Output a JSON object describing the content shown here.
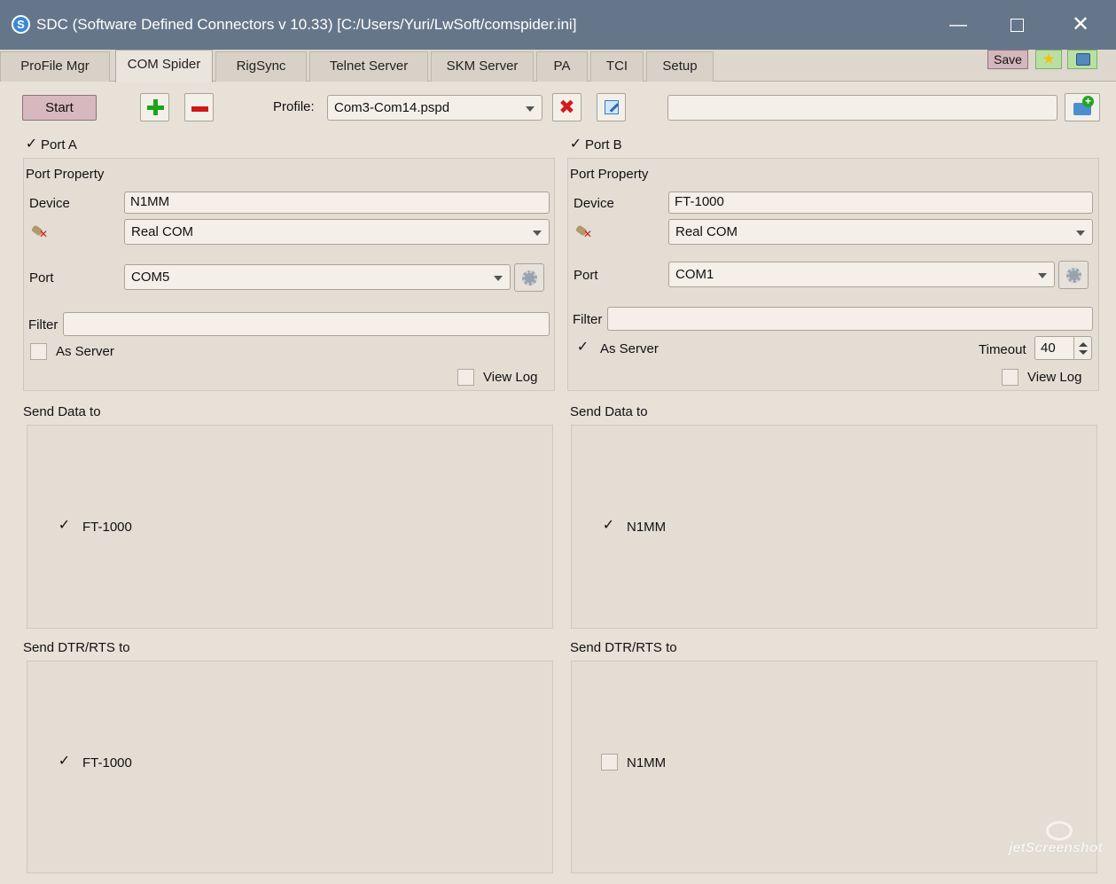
{
  "window": {
    "title": "SDC (Software Defined Connectors v 10.33) [C:/Users/Yuri/LwSoft/comspider.ini]",
    "app_icon_letter": "S",
    "min_glyph": "—",
    "close_glyph": "✕"
  },
  "tabs": [
    {
      "label": "ProFile Mgr"
    },
    {
      "label": "COM Spider"
    },
    {
      "label": "RigSync"
    },
    {
      "label": "Telnet Server"
    },
    {
      "label": "SKM Server"
    },
    {
      "label": "PA"
    },
    {
      "label": "TCI"
    },
    {
      "label": "Setup"
    }
  ],
  "active_tab": "COM Spider",
  "header_buttons": {
    "save_label": "Save",
    "star_glyph": "★"
  },
  "toolbar": {
    "start_label": "Start",
    "profile_label": "Profile:",
    "profile_value": "Com3-Com14.pspd",
    "delete_glyph": "✖",
    "path_value": ""
  },
  "port_a": {
    "enabled": true,
    "check_glyph": "✓",
    "title": "Port A",
    "section_title": "Port Property",
    "device_label": "Device",
    "device_value": "N1MM",
    "type_value": "Real COM",
    "port_label": "Port",
    "port_value": "COM5",
    "filter_label": "Filter",
    "filter_value": "",
    "as_server_label": "As Server",
    "as_server_checked": false,
    "view_log_label": "View Log",
    "view_log_checked": false,
    "send_data_title": "Send Data to",
    "send_data_target": "FT-1000",
    "send_data_checked": true,
    "send_dtr_title": "Send DTR/RTS to",
    "send_dtr_target": "FT-1000",
    "send_dtr_checked": true
  },
  "port_b": {
    "enabled": true,
    "check_glyph": "✓",
    "title": "Port B",
    "section_title": "Port Property",
    "device_label": "Device",
    "device_value": "FT-1000",
    "type_value": "Real COM",
    "port_label": "Port",
    "port_value": "COM1",
    "filter_label": "Filter",
    "filter_value": "",
    "as_server_label": "As Server",
    "as_server_checked": true,
    "timeout_label": "Timeout",
    "timeout_value": "40",
    "view_log_label": "View Log",
    "view_log_checked": false,
    "send_data_title": "Send Data to",
    "send_data_target": "N1MM",
    "send_data_checked": true,
    "send_dtr_title": "Send DTR/RTS to",
    "send_dtr_target": "N1MM",
    "send_dtr_checked": false
  },
  "watermark": "jetScreenshot",
  "colors": {
    "titlebar": "#66768a",
    "window_bg": "#e7e1d8",
    "start_button": "#d7b8be",
    "save_button": "#d4b6bd",
    "star_button": "#b9e0a3",
    "add_icon": "#1aa51a",
    "remove_icon": "#d11818"
  }
}
